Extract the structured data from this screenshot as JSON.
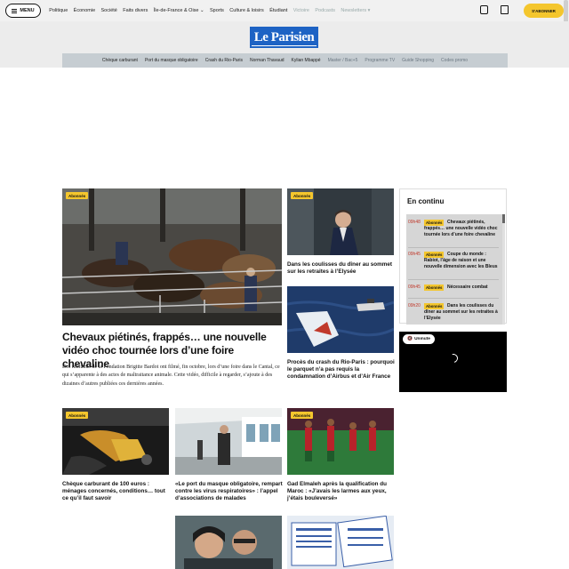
{
  "topbar": {
    "menu_label": "MENU",
    "nav_items": [
      "Politique",
      "Économie",
      "Société",
      "Faits divers",
      "Île-de-France & Oise ⌄",
      "Sports",
      "Culture & loisirs",
      "Étudiant"
    ],
    "nav_dim_items": [
      "Victoire",
      "Podcasts",
      "Newsletters ▾"
    ],
    "subscribe_label": "S'ABONNER"
  },
  "brand": {
    "logo_text": "Le Parisien",
    "accent": "#1e63c4",
    "badge_color": "#f4c62d"
  },
  "trends": {
    "items": [
      "Chèque carburant",
      "Port du masque obligatoire",
      "Crash du Rio-Paris",
      "Norman Thavaud",
      "Kylian Mbappé"
    ],
    "dim_items": [
      "Master / Bac+5",
      "Programme TV",
      "Guide Shopping",
      "Codes promo"
    ]
  },
  "articles": {
    "main": {
      "badge": "Abonnés",
      "title": "Chevaux piétinés, frappés… une nouvelle vidéo choc tournée lors d’une foire chevaline",
      "lead": "Des militants de la Fondation Brigitte Bardot ont filmé, fin octobre, lors d’une foire dans le Cantal, ce qui s’apparente à des actes de maltraitance animale. Cette vidéo, difficile à regarder, s’ajoute à des dizaines d’autres publiées ces dernières années."
    },
    "elysee": {
      "badge": "Abonnés",
      "title": "Dans les coulisses du dîner au sommet sur les retraites à l’Elysée"
    },
    "rio": {
      "title": "Procès du crash du Rio-Paris : pourquoi le parquet n’a pas requis la condamnation d’Airbus et d’Air France"
    },
    "fuel": {
      "badge": "Abonnés",
      "title": "Chèque carburant de 100 euros : ménages concernés, conditions… tout ce qu’il faut savoir"
    },
    "mask": {
      "title": "«Le port du masque obligatoire, rempart contre les virus respiratoires» : l’appel d’associations de malades"
    },
    "football": {
      "badge": "Abonnés",
      "title": "Gad Elmaleh après la qualification du Maroc : «J’avais les larmes aux yeux, j’étais bouleversé»"
    }
  },
  "live": {
    "heading": "En continu",
    "items": [
      {
        "time": "09h48",
        "tag": "Abonnés",
        "text": "Chevaux piétinés, frappés… une nouvelle vidéo choc tournée lors d’une foire chevaline"
      },
      {
        "time": "09h45",
        "tag": "Abonnés",
        "text": "Coupe du monde : Rabiot, l’âge de raison et une nouvelle dimension avec les Bleus"
      },
      {
        "time": "09h45",
        "tag": "Abonnés",
        "text": "Nécessaire combat"
      },
      {
        "time": "09h20",
        "tag": "Abonnés",
        "text": "Dans les coulisses du dîner au sommet sur les retraites à l’Elysée"
      }
    ]
  },
  "video": {
    "unmute_label": "Unmute"
  }
}
